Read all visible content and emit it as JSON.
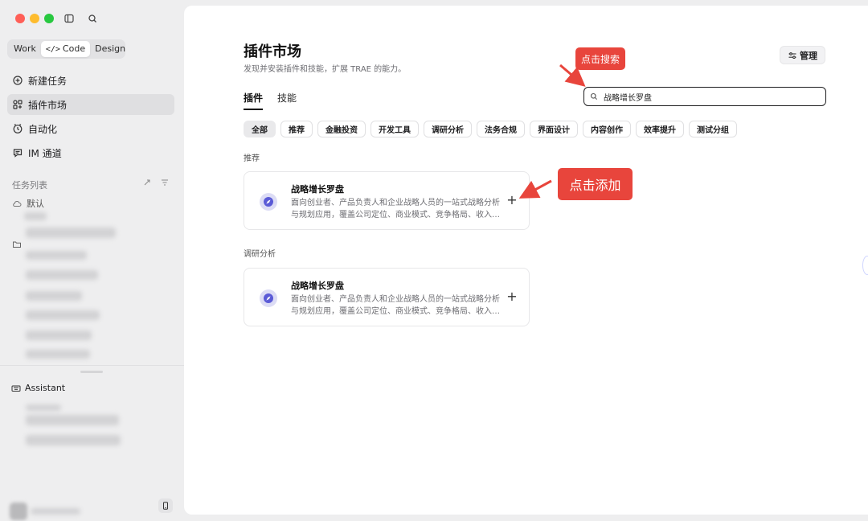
{
  "sidebar": {
    "modes": [
      "Work",
      "Code",
      "Design"
    ],
    "active_mode": "Code",
    "nav": [
      {
        "label": "新建任务",
        "icon": "plus-circle-icon"
      },
      {
        "label": "插件市场",
        "icon": "puzzle-icon"
      },
      {
        "label": "自动化",
        "icon": "clock-icon"
      },
      {
        "label": "IM 通道",
        "icon": "chat-icon"
      }
    ],
    "active_nav": "插件市场",
    "task_list_title": "任务列表",
    "default_group": "默认",
    "assistant_label": "Assistant"
  },
  "main": {
    "title": "插件市场",
    "subtitle": "发现并安装插件和技能，扩展 TRAE 的能力。",
    "manage_label": "管理",
    "tabs": [
      {
        "label": "插件",
        "active": true
      },
      {
        "label": "技能",
        "active": false
      }
    ],
    "search_value": "战略增长罗盘",
    "filters": [
      "全部",
      "推荐",
      "金融投资",
      "开发工具",
      "调研分析",
      "法务合规",
      "界面设计",
      "内容创作",
      "效率提升",
      "测试分组"
    ],
    "active_filter": "全部",
    "groups": [
      {
        "label": "推荐",
        "plugin": {
          "name": "战略增长罗盘",
          "description": "面向创业者、产品负责人和企业战略人员的一站式战略分析与规划应用，覆盖公司定位、商业模式、竞争格局、收入结构等"
        }
      },
      {
        "label": "调研分析",
        "plugin": {
          "name": "战略增长罗盘",
          "description": "面向创业者、产品负责人和企业战略人员的一站式战略分析与规划应用，覆盖公司定位、商业模式、竞争格局、收入结构等"
        }
      }
    ]
  },
  "annotations": {
    "search_hint": "点击搜索",
    "add_hint": "点击添加",
    "color": "#e8453c"
  }
}
